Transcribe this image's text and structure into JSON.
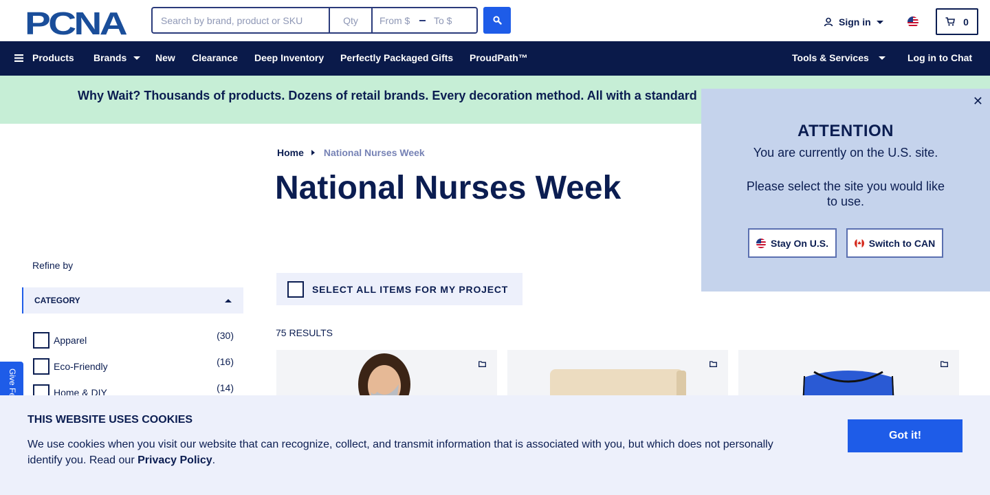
{
  "header": {
    "logo_text": "PCNA",
    "search": {
      "placeholder": "Search by brand, product or SKU",
      "qty_placeholder": "Qty",
      "from_placeholder": "From $",
      "to_placeholder": "To $"
    },
    "signin_label": "Sign in",
    "cart_count": "0"
  },
  "nav": {
    "products": "Products",
    "brands": "Brands",
    "new": "New",
    "clearance": "Clearance",
    "deep_inventory": "Deep Inventory",
    "gifts": "Perfectly Packaged Gifts",
    "proudpath": "ProudPath™",
    "tools": "Tools & Services",
    "chat": "Log in to Chat"
  },
  "promo": {
    "text": "Why Wait? Thousands of products. Dozens of retail brands. Every decoration method. All with a standard"
  },
  "breadcrumb": {
    "home": "Home",
    "current": "National Nurses Week"
  },
  "page_title": "National Nurses Week",
  "sidebar": {
    "refine_label": "Refine by",
    "category_label": "CATEGORY",
    "facets": [
      {
        "label": "Apparel",
        "count": "(30)"
      },
      {
        "label": "Eco-Friendly",
        "count": "(16)"
      },
      {
        "label": "Home & DIY",
        "count": "(14)"
      }
    ]
  },
  "listing": {
    "select_all_label": "SELECT ALL ITEMS FOR MY PROJECT",
    "results_label": "75 RESULTS"
  },
  "feedback_label": "Give Feedback",
  "attention": {
    "title": "ATTENTION",
    "line1": "You are currently on the U.S. site.",
    "line2": "Please select the site you would like to use.",
    "stay_label": "Stay On U.S.",
    "switch_label": "Switch to CAN"
  },
  "cookie": {
    "title": "THIS WEBSITE USES COOKIES",
    "text": "We use cookies when you visit our website that can recognize, collect, and transmit information that is associated with you, but which does not personally identify you. Read our",
    "policy_link": "Privacy Policy",
    "period": ".",
    "button_label": "Got it!"
  },
  "colors": {
    "navy": "#0a1a4a",
    "accent": "#1e5ce8",
    "promo_bg": "#c6eed6",
    "popup_bg": "#c5d3ec",
    "panel_bg": "#edf0fb"
  }
}
